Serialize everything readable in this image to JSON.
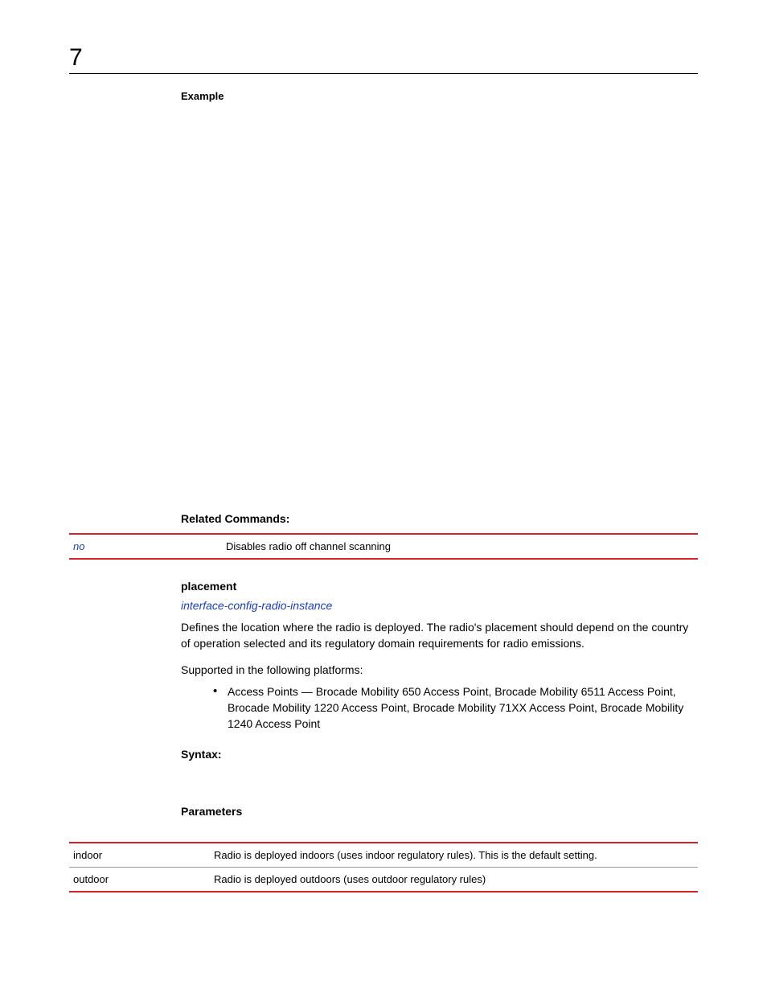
{
  "chapter": "7",
  "example_heading": "Example",
  "related_heading": "Related Commands:",
  "related_rows": [
    {
      "left": "no",
      "right": "Disables radio off channel scanning"
    }
  ],
  "sub_heading": "placement",
  "link_text": "interface-config-radio-instance",
  "body_text": "Defines the location where the radio is deployed. The radio's placement should depend on the country of operation selected and its regulatory domain requirements for radio emissions.",
  "support_text": "Supported in the following platforms:",
  "bullet_text": "Access Points — Brocade Mobility 650 Access Point, Brocade Mobility 6511 Access Point, Brocade Mobility 1220 Access Point, Brocade Mobility 71XX Access Point, Brocade Mobility 1240 Access Point",
  "syntax_heading": "Syntax:",
  "params_heading": "Parameters",
  "param_rows": [
    {
      "left": "indoor",
      "right": "Radio is deployed indoors (uses indoor regulatory rules). This is the default setting."
    },
    {
      "left": "outdoor",
      "right": "Radio is deployed outdoors (uses outdoor regulatory rules)"
    }
  ]
}
